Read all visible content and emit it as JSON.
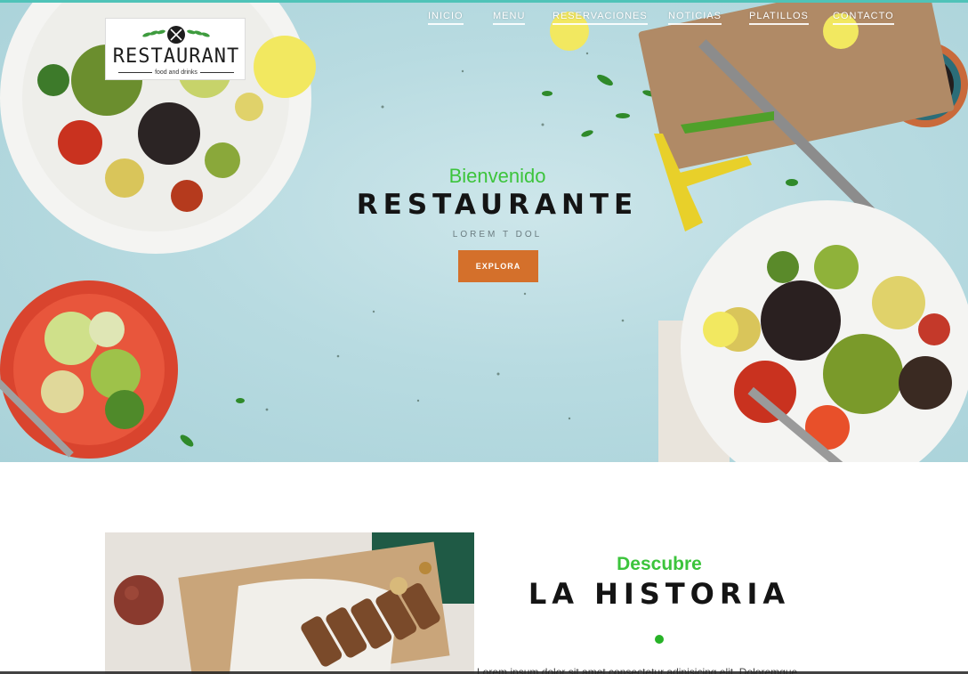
{
  "logo": {
    "brand": "RESTAURANT",
    "tagline": "food and drinks",
    "icon": "fork-knife-laurel-icon"
  },
  "nav": {
    "items": [
      {
        "label": "INICIO",
        "active": true
      },
      {
        "label": "MENU"
      },
      {
        "label": "RESERVACIONES"
      },
      {
        "label": "NOTICIAS"
      },
      {
        "label": "PLATILLOS"
      },
      {
        "label": "CONTACTO"
      }
    ]
  },
  "hero": {
    "welcome": "Bienvenido",
    "title": "RESTAURANTE",
    "subtitle": "LOREM T DOL",
    "cta_label": "EXPLORA"
  },
  "story": {
    "kicker": "Descubre",
    "title": "LA HISTORIA",
    "paragraph": "Lorem ipsum dolor sit amet consectetur adipisicing elit. Doloremque"
  },
  "colors": {
    "accent_green": "#3cc43c",
    "button_orange": "#d4702b",
    "hero_background": "#b8dbe1",
    "dark_text": "#141414"
  }
}
